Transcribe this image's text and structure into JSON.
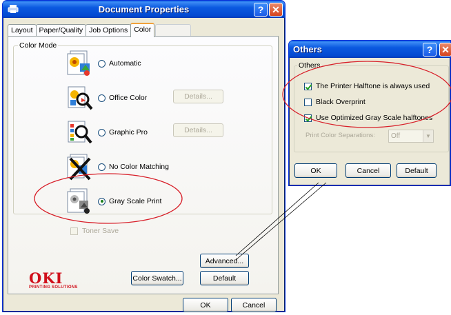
{
  "main_window": {
    "title": "Document Properties",
    "tabs": [
      {
        "label": "Layout",
        "active": false
      },
      {
        "label": "Paper/Quality",
        "active": false
      },
      {
        "label": "Job Options",
        "active": false
      },
      {
        "label": "Color",
        "active": true
      }
    ],
    "color_mode_group": "Color Mode",
    "modes": [
      {
        "label": "Automatic",
        "selected": false,
        "icon": "color-automatic-icon"
      },
      {
        "label": "Office Color",
        "selected": false,
        "icon": "office-color-icon"
      },
      {
        "label": "Graphic Pro",
        "selected": false,
        "icon": "graphic-pro-icon"
      },
      {
        "label": "No Color Matching",
        "selected": false,
        "icon": "no-color-matching-icon"
      },
      {
        "label": "Gray Scale Print",
        "selected": true,
        "icon": "gray-scale-print-icon"
      }
    ],
    "details_label": "Details...",
    "toner_save_label": "Toner Save",
    "advanced_label": "Advanced...",
    "color_swatch_label": "Color Swatch...",
    "default_label": "Default",
    "ok_label": "OK",
    "cancel_label": "Cancel",
    "logo_text": "OKI",
    "logo_sub": "PRINTING SOLUTIONS"
  },
  "others_dialog": {
    "title": "Others",
    "group_label": "Others",
    "options": [
      {
        "label": "The Printer Halftone is always used",
        "checked": true
      },
      {
        "label": "Black Overprint",
        "checked": false
      },
      {
        "label": "Use Optimized Gray Scale halftones",
        "checked": true
      }
    ],
    "separations_label": "Print Color Separations:",
    "separations_value": "Off",
    "ok_label": "OK",
    "cancel_label": "Cancel",
    "default_label": "Default"
  },
  "colors": {
    "highlight_ellipse": "#d8202a",
    "title_bar": "#0349d1",
    "dialog_bg": "#ece9d8"
  }
}
